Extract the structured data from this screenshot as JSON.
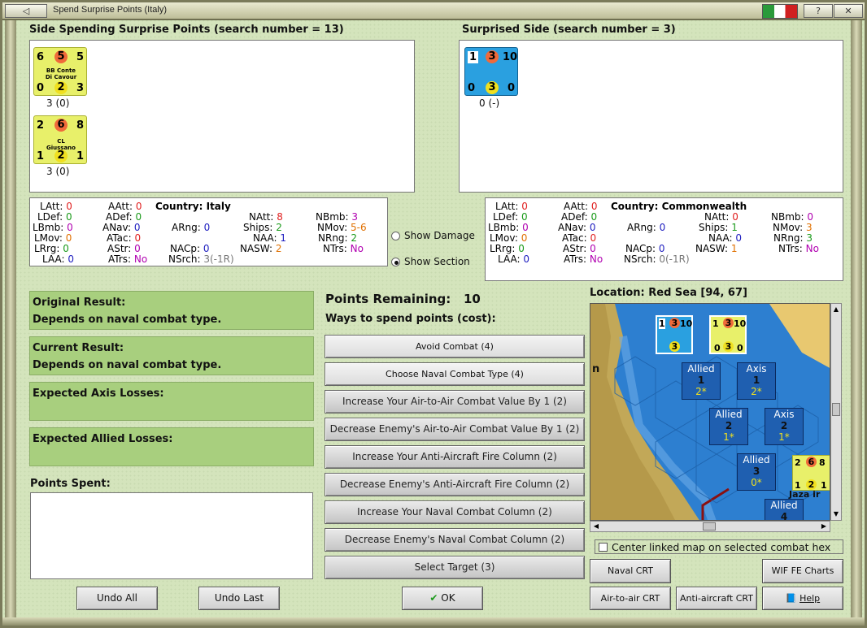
{
  "window": {
    "title": "Spend Surprise Points (Italy)"
  },
  "title_buttons": {
    "help": "?"
  },
  "left_side": {
    "header": "Side Spending Surprise Points (search number = 13)",
    "units": [
      {
        "top_left": "6",
        "top_mid": "5",
        "top_right": "5",
        "name": "BB Conte Di Cavour",
        "bot_left": "0",
        "bot_mid": "2",
        "bot_right": "3",
        "caption": "3 (0)"
      },
      {
        "top_left": "2",
        "top_mid": "6",
        "top_right": "8",
        "name": "CL Giussano",
        "bot_left": "1",
        "bot_mid": "2",
        "bot_right": "1",
        "caption": "3 (0)"
      }
    ]
  },
  "right_side": {
    "header": "Surprised Side (search number = 3)",
    "units": [
      {
        "top_left": "1",
        "top_mid": "3",
        "top_right": "10",
        "bot_left": "0",
        "bot_mid": "3",
        "bot_right": "0",
        "caption": "0 (-)"
      }
    ]
  },
  "left_stats": {
    "country_label": "Country:",
    "country": "Italy",
    "LAtt": "0",
    "LDef": "0",
    "LBmb": "0",
    "LMov": "0",
    "LRrg": "0",
    "LAA": "0",
    "AAtt": "0",
    "ADef": "0",
    "ANav": "0",
    "ATac": "0",
    "AStr": "0",
    "ATrs": "No",
    "ARng": "0",
    "NACp": "0",
    "NSrch": "3(-1R)",
    "NAtt": "8",
    "Ships": "2",
    "NAA": "1",
    "NASW": "2",
    "NBmb": "3",
    "NMov": "5-6",
    "NRng": "2",
    "NTrs": "No"
  },
  "right_stats": {
    "country_label": "Country:",
    "country": "Commonwealth",
    "LAtt": "0",
    "LDef": "0",
    "LBmb": "0",
    "LMov": "0",
    "LRrg": "0",
    "LAA": "0",
    "AAtt": "0",
    "ADef": "0",
    "ANav": "0",
    "ATac": "0",
    "AStr": "0",
    "ATrs": "No",
    "ARng": "0",
    "NACp": "0",
    "NSrch": "0(-1R)",
    "NAtt": "0",
    "Ships": "1",
    "NAA": "0",
    "NASW": "1",
    "NBmb": "0",
    "NMov": "3",
    "NRng": "3",
    "NTrs": "No"
  },
  "options": {
    "show_damage": "Show Damage",
    "show_section": "Show Section",
    "selected": "Show Section"
  },
  "results": {
    "original_label": "Original Result:",
    "original_value": "Depends on naval combat type.",
    "current_label": "Current Result:",
    "current_value": "Depends on naval combat type.",
    "axis_losses_label": "Expected Axis Losses:",
    "allied_losses_label": "Expected Allied Losses:",
    "points_spent_label": "Points Spent:"
  },
  "points": {
    "remaining_label": "Points Remaining:",
    "remaining_value": "10",
    "ways_label": "Ways to spend points (cost):"
  },
  "spend_options": [
    "Avoid Combat (4)",
    "Choose Naval Combat Type (4)",
    "Increase Your Air-to-Air Combat Value By 1 (2)",
    "Decrease Enemy's Air-to-Air Combat Value By 1 (2)",
    "Increase Your Anti-Aircraft Fire Column (2)",
    "Decrease Enemy's Anti-Aircraft Fire Column (2)",
    "Increase Your Naval Combat Column (2)",
    "Decrease Enemy's Naval Combat Column (2)",
    "Select Target (3)"
  ],
  "buttons": {
    "undo_all": "Undo All",
    "undo_last": "Undo Last",
    "ok": "OK",
    "naval_crt": "Naval CRT",
    "wif_fe_charts": "WIF FE Charts",
    "air_to_air_crt": "Air-to-air CRT",
    "anti_aircraft_crt": "Anti-aircraft CRT",
    "help": "Help"
  },
  "map": {
    "location": "Location: Red Sea [94, 67]",
    "center_checkbox": "Center linked map on selected combat hex",
    "boxes": [
      {
        "side": "Allied",
        "num": "1",
        "val": "2*"
      },
      {
        "side": "Axis",
        "num": "1",
        "val": "2*"
      },
      {
        "side": "Allied",
        "num": "2",
        "val": "1*"
      },
      {
        "side": "Axis",
        "num": "2",
        "val": "1*"
      },
      {
        "side": "Allied",
        "num": "3",
        "val": "0*"
      },
      {
        "side": "Allied",
        "num": "4",
        "val": ""
      }
    ],
    "place_label": "Jaza ir",
    "hex_letter": "n"
  },
  "colors": {
    "panel_green": "#a8cf7e",
    "sea": "#2d7fd0",
    "axis_counter": "#e8f06a",
    "allied_counter": "#2aa0e0"
  }
}
